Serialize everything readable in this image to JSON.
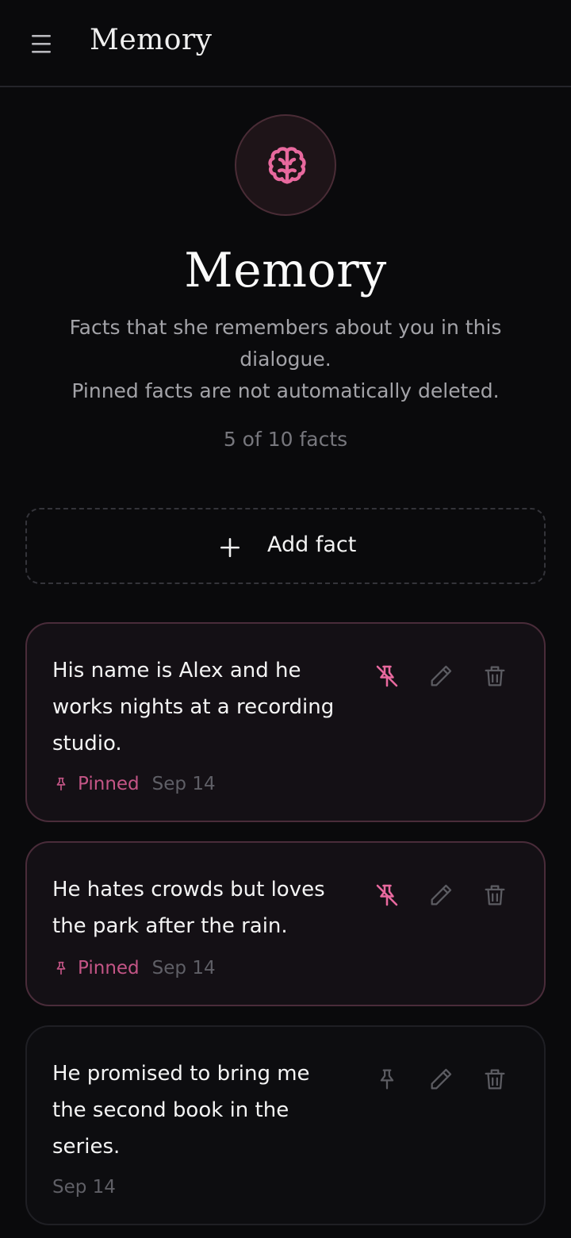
{
  "header": {
    "title": "Memory",
    "menu_icon": "hamburger-menu-icon"
  },
  "hero": {
    "icon": "brain-icon",
    "title": "Memory",
    "description_line1": "Facts that she remembers about you in this dialogue.",
    "description_line2": "Pinned facts are not automatically deleted.",
    "count": "5 of 10 facts"
  },
  "add_fact": {
    "label": "Add fact",
    "icon": "plus-icon"
  },
  "facts": [
    {
      "text": "His name is Alex and he works nights at a recording studio.",
      "pinned": true,
      "pinned_label": "Pinned",
      "date": "Sep 14"
    },
    {
      "text": "He hates crowds but loves the park after the rain.",
      "pinned": true,
      "pinned_label": "Pinned",
      "date": "Sep 14"
    },
    {
      "text": "He promised to bring me the second book in the series.",
      "pinned": false,
      "date": "Sep 14"
    }
  ],
  "colors": {
    "background": "#0a0a0c",
    "accent_pink": "#e8699e",
    "pinned_label": "#c45586",
    "muted_text": "#77777d",
    "icon_gray": "#5c5c62"
  }
}
